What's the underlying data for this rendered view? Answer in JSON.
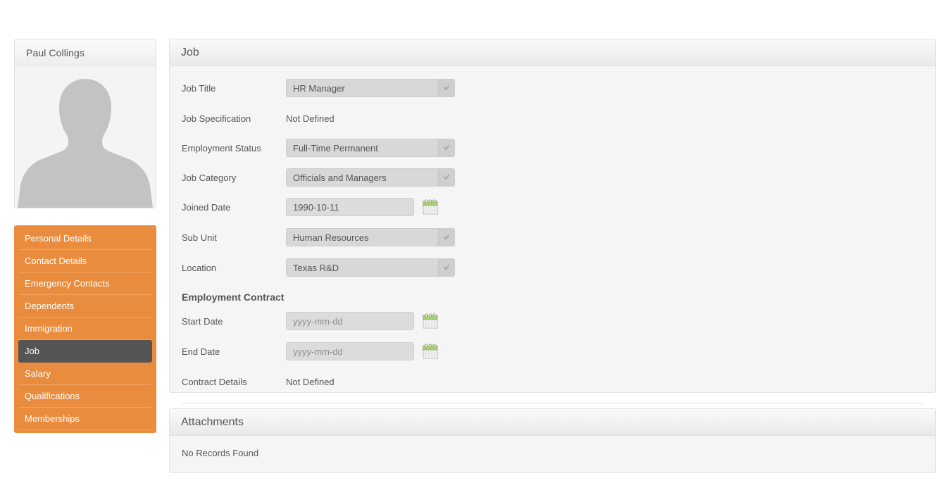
{
  "profile": {
    "name": "Paul Collings",
    "avatar_icon": "person-silhouette-icon"
  },
  "sidebar": {
    "items": [
      {
        "label": "Personal Details",
        "active": false
      },
      {
        "label": "Contact Details",
        "active": false
      },
      {
        "label": "Emergency Contacts",
        "active": false
      },
      {
        "label": "Dependents",
        "active": false
      },
      {
        "label": "Immigration",
        "active": false
      },
      {
        "label": "Job",
        "active": true
      },
      {
        "label": "Salary",
        "active": false
      },
      {
        "label": "Qualifications",
        "active": false
      },
      {
        "label": "Memberships",
        "active": false
      }
    ]
  },
  "job_panel": {
    "title": "Job",
    "fields": {
      "job_title": {
        "label": "Job Title",
        "value": "HR Manager"
      },
      "job_specification": {
        "label": "Job Specification",
        "value": "Not Defined"
      },
      "employment_status": {
        "label": "Employment Status",
        "value": "Full-Time Permanent"
      },
      "job_category": {
        "label": "Job Category",
        "value": "Officials and Managers"
      },
      "joined_date": {
        "label": "Joined Date",
        "value": "1990-10-11"
      },
      "sub_unit": {
        "label": "Sub Unit",
        "value": "Human Resources"
      },
      "location": {
        "label": "Location",
        "value": "Texas R&D"
      }
    },
    "employment_contract": {
      "heading": "Employment Contract",
      "start_date": {
        "label": "Start Date",
        "placeholder": "yyyy-mm-dd",
        "value": ""
      },
      "end_date": {
        "label": "End Date",
        "placeholder": "yyyy-mm-dd",
        "value": ""
      },
      "contract_details": {
        "label": "Contract Details",
        "value": "Not Defined"
      }
    },
    "calendar_icon": "calendar-icon"
  },
  "attachments_panel": {
    "title": "Attachments",
    "empty_message": "No Records Found"
  },
  "colors": {
    "sidebar_orange": "#ea8c3e",
    "sidebar_active": "#555555",
    "panel_bg": "#f5f5f5",
    "text": "#555555",
    "calendar_green": "#a8cf7d"
  }
}
